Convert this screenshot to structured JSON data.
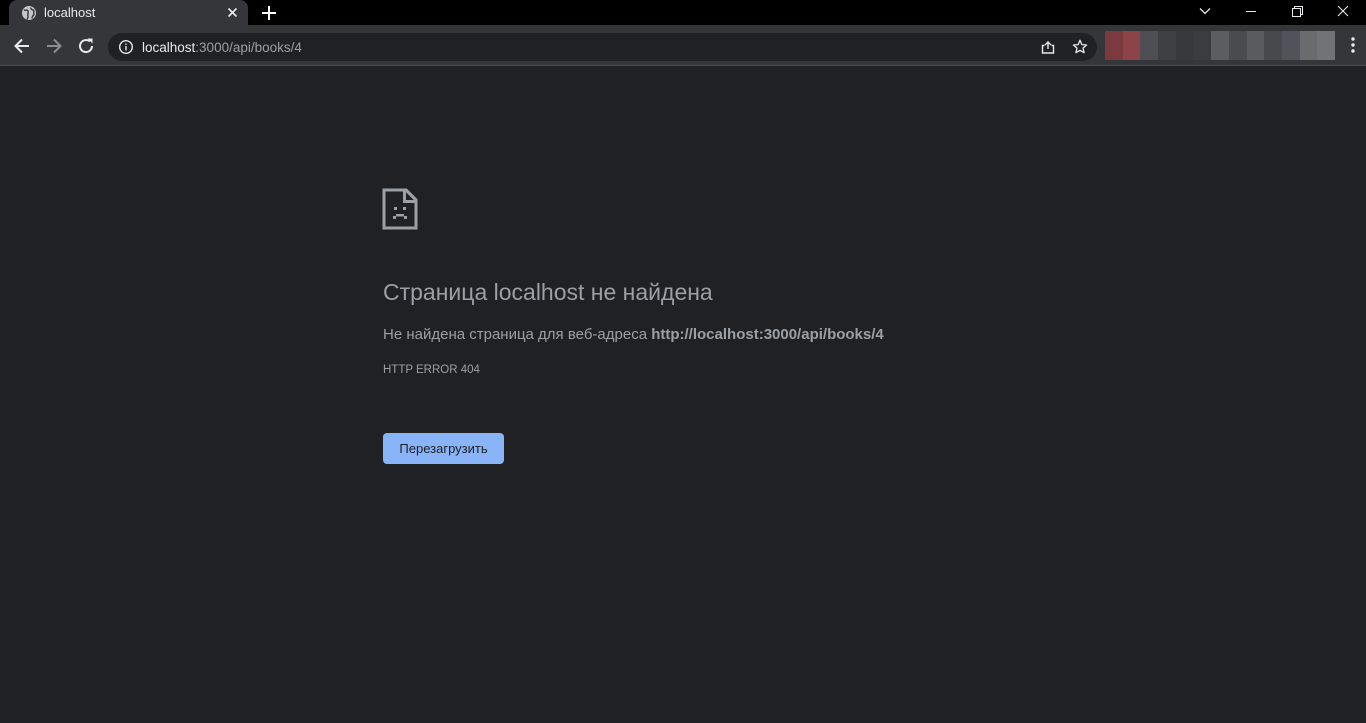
{
  "browser": {
    "tab": {
      "title": "localhost",
      "favicon_icon": "globe-icon",
      "close_icon": "close-icon"
    },
    "new_tab_icon": "plus-icon",
    "window_controls": [
      "chevron-down-icon",
      "minimize-icon",
      "restore-icon",
      "close-icon"
    ],
    "address_bar": {
      "host": "localhost",
      "path": ":3000/api/books/4",
      "info_icon": "info-icon",
      "share_icon": "share-icon",
      "bookmark_icon": "star-icon"
    },
    "extensions_blurred": true
  },
  "error_page": {
    "heading": "Страница localhost не найдена",
    "description_prefix": "Не найдена страница для веб-адреса ",
    "description_url": "http://localhost:3000/api/books/4",
    "error_code": "HTTP ERROR 404",
    "reload_button_label": "Перезагрузить",
    "icon": "sad-page-icon"
  },
  "colors": {
    "page_background": "#202124",
    "text": "#9aa0a6",
    "button": "#8ab4f8",
    "toolbar": "#35363a"
  }
}
